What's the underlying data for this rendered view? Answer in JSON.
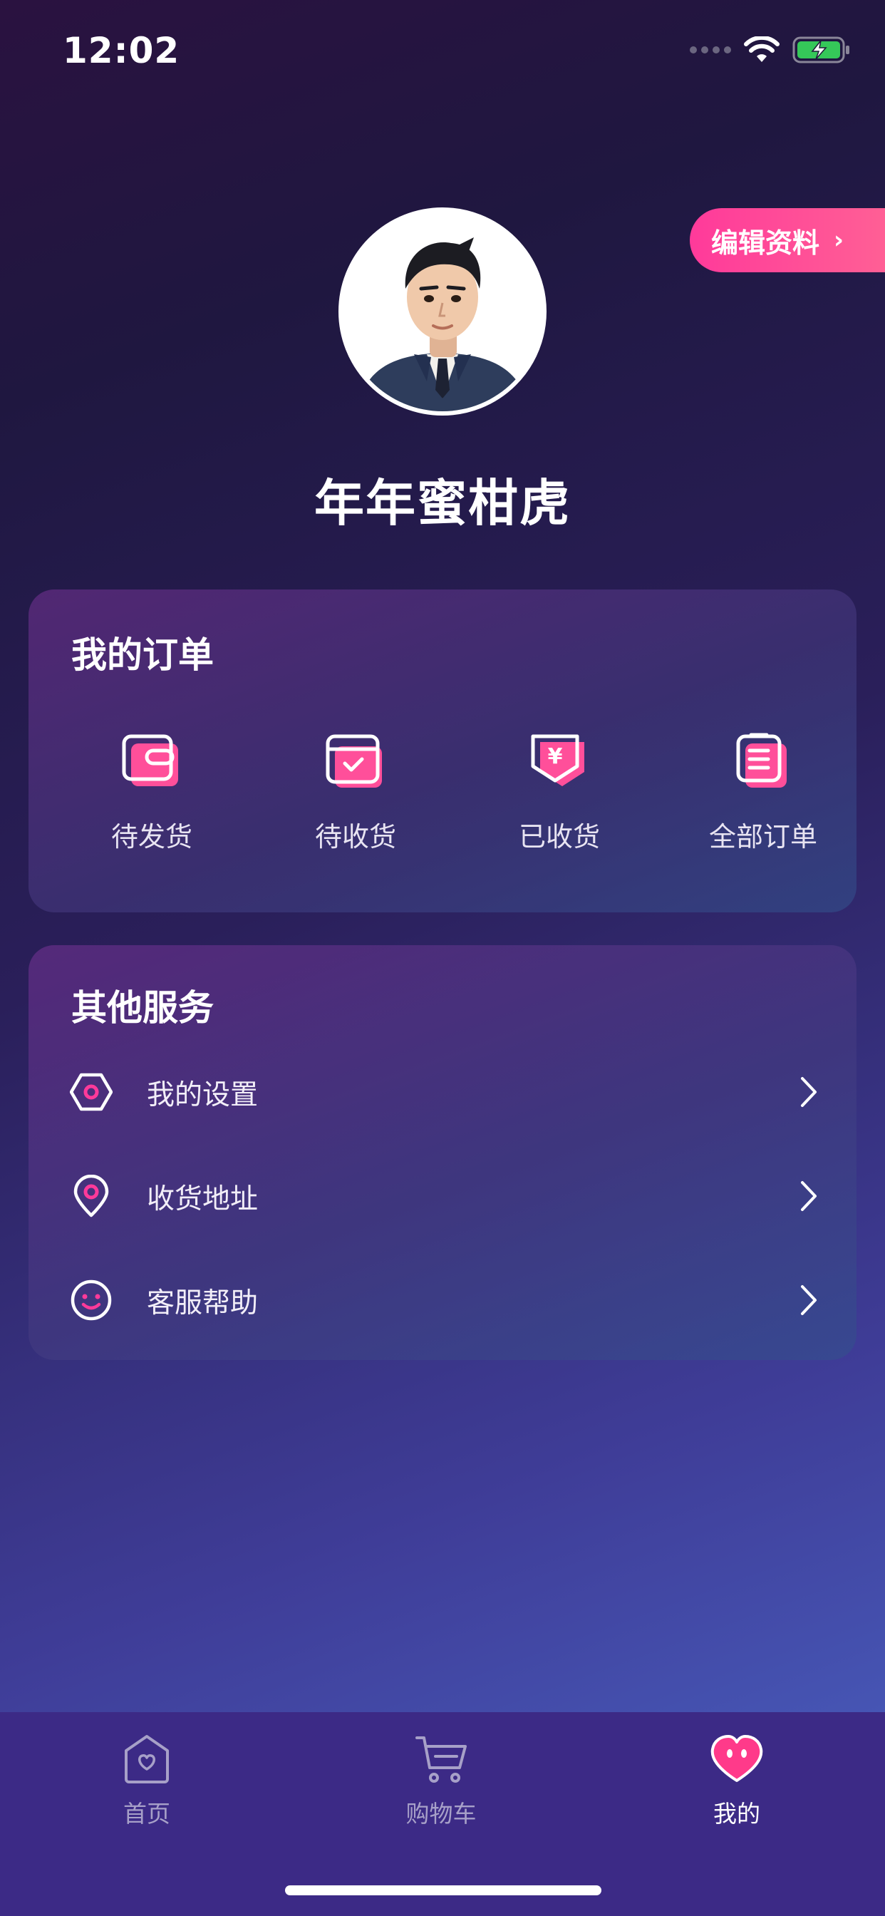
{
  "status_bar": {
    "time": "12:02"
  },
  "profile": {
    "name": "年年蜜柑虎",
    "edit_label": "编辑资料"
  },
  "orders": {
    "title": "我的订单",
    "items": [
      {
        "label": "待发货",
        "icon": "wallet-icon"
      },
      {
        "label": "待收货",
        "icon": "calendar-check-icon"
      },
      {
        "label": "已收货",
        "icon": "yen-shield-icon"
      },
      {
        "label": "全部订单",
        "icon": "clipboard-list-icon"
      }
    ]
  },
  "services": {
    "title": "其他服务",
    "items": [
      {
        "label": "我的设置",
        "icon": "hexagon-settings-icon"
      },
      {
        "label": "收货地址",
        "icon": "location-pin-icon"
      },
      {
        "label": "客服帮助",
        "icon": "smiley-icon"
      }
    ]
  },
  "tab_bar": {
    "items": [
      {
        "label": "首页",
        "icon": "home-heart-icon",
        "active": false
      },
      {
        "label": "购物车",
        "icon": "cart-icon",
        "active": false
      },
      {
        "label": "我的",
        "icon": "heart-face-icon",
        "active": true
      }
    ]
  },
  "colors": {
    "accent": "#ff3a9a",
    "tab_bar": "#3c2a86",
    "battery": "#35c759"
  }
}
